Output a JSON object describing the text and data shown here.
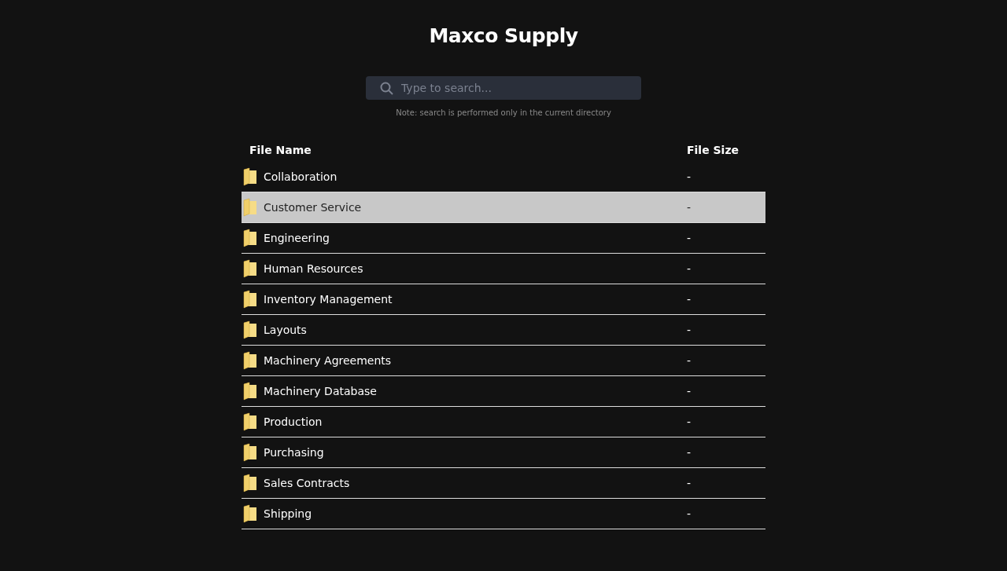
{
  "title": "Maxco Supply",
  "search": {
    "placeholder": "Type to search...",
    "note": "Note: search is performed only in the current directory"
  },
  "table": {
    "columns": [
      "File Name",
      "File Size"
    ],
    "rows": [
      {
        "name": "Collaboration",
        "size": "-",
        "selected": false
      },
      {
        "name": "Customer Service",
        "size": "-",
        "selected": true
      },
      {
        "name": "Engineering",
        "size": "-",
        "selected": false
      },
      {
        "name": "Human Resources",
        "size": "-",
        "selected": false
      },
      {
        "name": "Inventory Management",
        "size": "-",
        "selected": false
      },
      {
        "name": "Layouts",
        "size": "-",
        "selected": false
      },
      {
        "name": "Machinery Agreements",
        "size": "-",
        "selected": false
      },
      {
        "name": "Machinery Database",
        "size": "-",
        "selected": false
      },
      {
        "name": "Production",
        "size": "-",
        "selected": false
      },
      {
        "name": "Purchasing",
        "size": "-",
        "selected": false
      },
      {
        "name": "Sales Contracts",
        "size": "-",
        "selected": false
      },
      {
        "name": "Shipping",
        "size": "-",
        "selected": false
      }
    ]
  }
}
